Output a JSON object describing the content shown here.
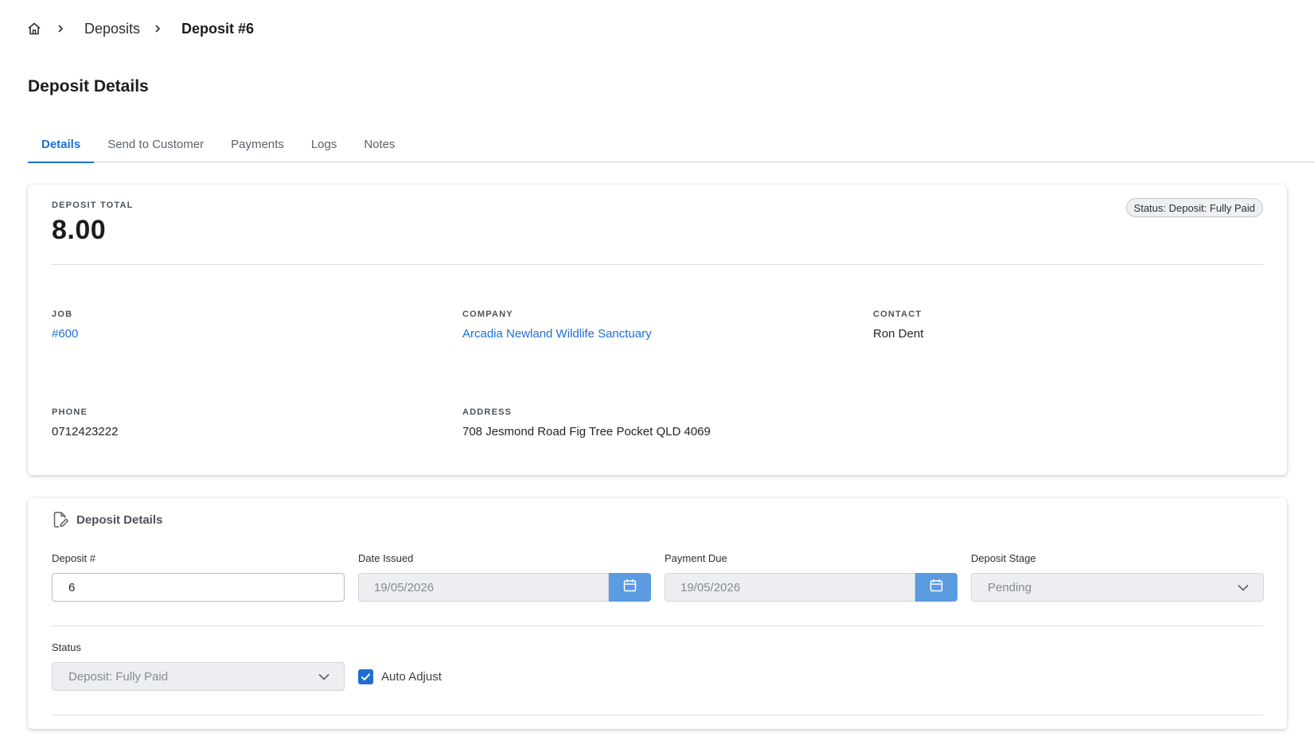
{
  "breadcrumb": {
    "home_icon": "home-icon",
    "items": [
      "Deposits",
      "Deposit #6"
    ]
  },
  "page": {
    "title": "Deposit Details"
  },
  "tabs": [
    {
      "label": "Details",
      "active": true
    },
    {
      "label": "Send to Customer",
      "active": false
    },
    {
      "label": "Payments",
      "active": false
    },
    {
      "label": "Logs",
      "active": false
    },
    {
      "label": "Notes",
      "active": false
    }
  ],
  "summary": {
    "total_label": "DEPOSIT TOTAL",
    "total_value": "8.00",
    "status_badge": "Status: Deposit: Fully Paid",
    "job_label": "JOB",
    "job_value": "#600",
    "company_label": "COMPANY",
    "company_value": "Arcadia Newland Wildlife Sanctuary",
    "contact_label": "CONTACT",
    "contact_value": "Ron Dent",
    "phone_label": "PHONE",
    "phone_value": "0712423222",
    "address_label": "ADDRESS",
    "address_value": "708 Jesmond Road Fig Tree Pocket QLD 4069"
  },
  "form": {
    "section_title": "Deposit Details",
    "deposit_number_label": "Deposit #",
    "deposit_number_value": "6",
    "date_issued_label": "Date Issued",
    "date_issued_value": "19/05/2026",
    "payment_due_label": "Payment Due",
    "payment_due_value": "19/05/2026",
    "deposit_stage_label": "Deposit Stage",
    "deposit_stage_value": "Pending",
    "status_label": "Status",
    "status_value": "Deposit: Fully Paid",
    "auto_adjust_label": "Auto Adjust",
    "auto_adjust_checked": true
  },
  "colors": {
    "accent": "#1f6fd1",
    "date_button": "#5b9be0"
  }
}
